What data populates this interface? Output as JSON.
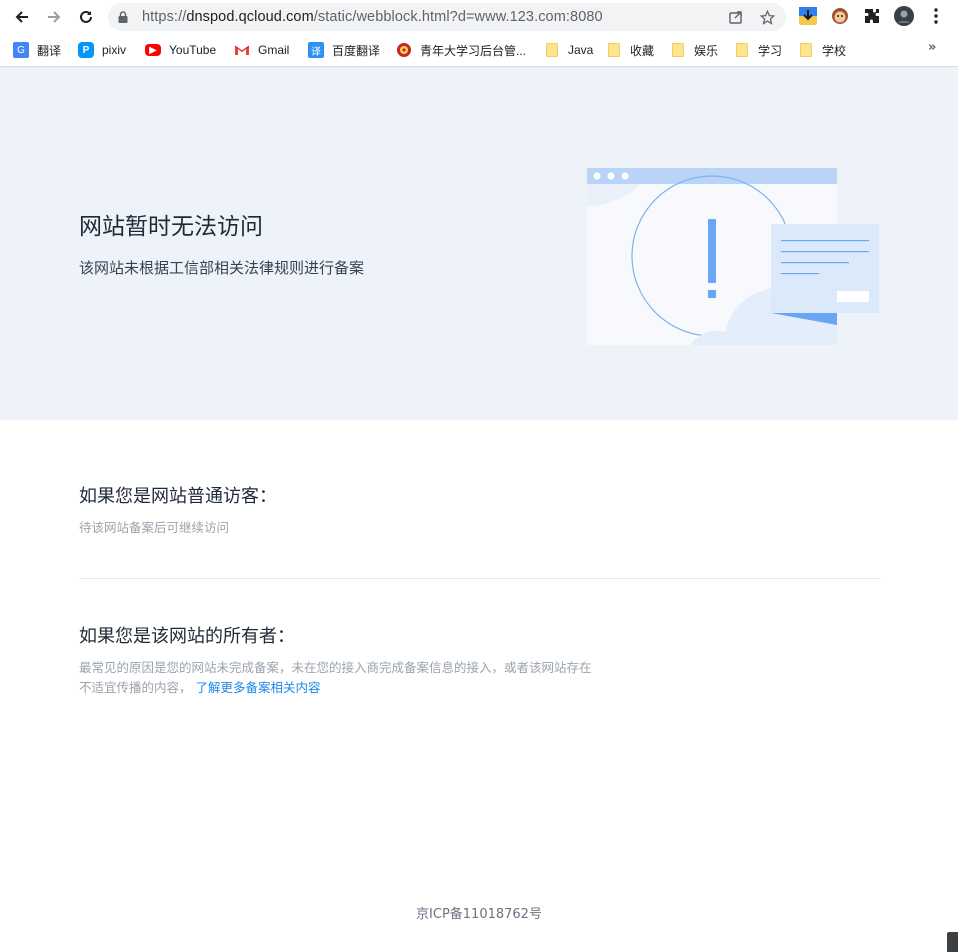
{
  "browser": {
    "url_scheme": "https://",
    "url_host": "dnspod.qcloud.com",
    "url_path": "/static/webblock.html?d=www.123.com:8080"
  },
  "bookmarks": [
    {
      "label": "翻译",
      "icon": "google-translate-icon"
    },
    {
      "label": "pixiv",
      "icon": "pixiv-icon"
    },
    {
      "label": "YouTube",
      "icon": "youtube-icon"
    },
    {
      "label": "Gmail",
      "icon": "gmail-icon"
    },
    {
      "label": "百度翻译",
      "icon": "baidu-translate-icon"
    },
    {
      "label": "青年大学习后台管...",
      "icon": "youth-league-icon"
    },
    {
      "label": "Java",
      "icon": "folder-icon"
    },
    {
      "label": "收藏",
      "icon": "folder-icon"
    },
    {
      "label": "娱乐",
      "icon": "folder-icon"
    },
    {
      "label": "学习",
      "icon": "folder-icon"
    },
    {
      "label": "学校",
      "icon": "folder-icon"
    }
  ],
  "hero": {
    "title": "网站暂时无法访问",
    "subtitle": "该网站未根据工信部相关法律规则进行备案"
  },
  "visitor": {
    "title": "如果您是网站普通访客：",
    "text": "待该网站备案后可继续访问"
  },
  "owner": {
    "title": "如果您是该网站的所有者：",
    "text_line1": "最常见的原因是您的网站未完成备案，未在您的接入商完成备案信息的接入，或者该网站存在",
    "text_line2": "不适宜传播的内容，",
    "link": "了解更多备案相关内容"
  },
  "footer": {
    "icp": "京ICP备11018762号"
  },
  "colors": {
    "hero_bg": "#eef3fa",
    "accent_blue": "#6aa6f3",
    "link": "#1e88e5"
  }
}
